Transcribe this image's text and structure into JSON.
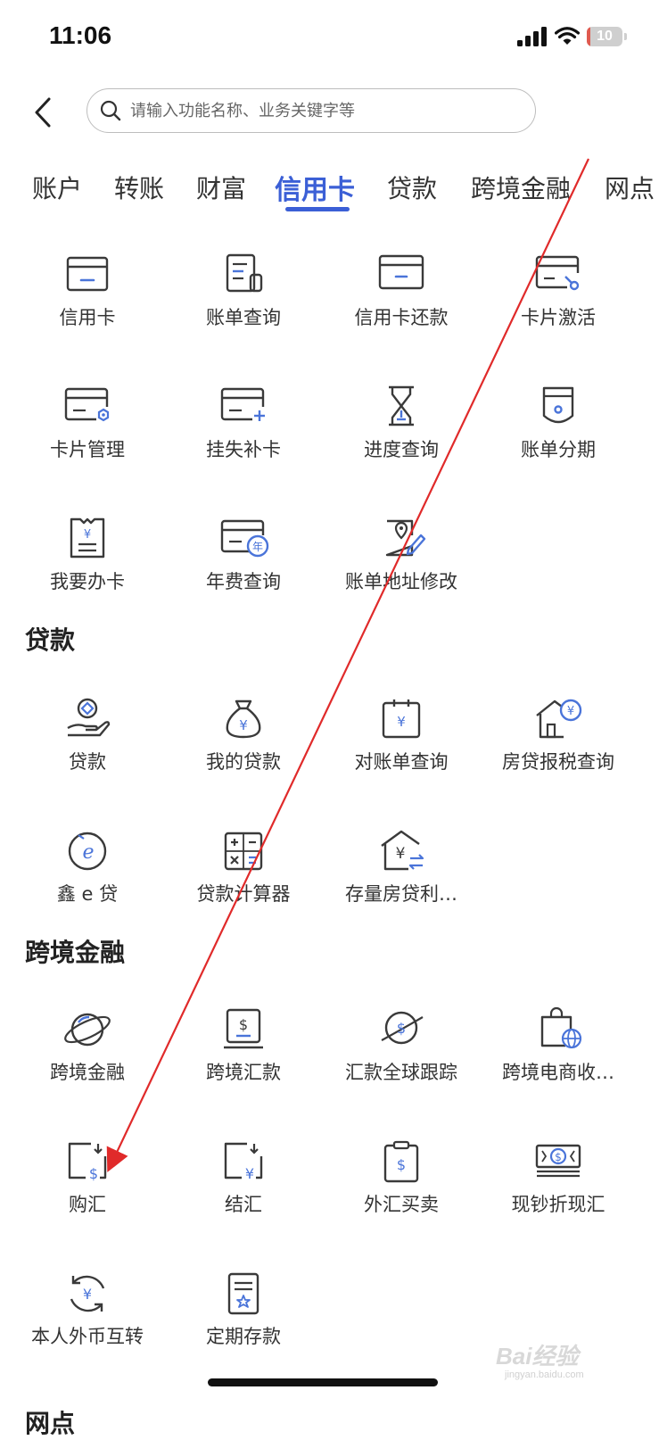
{
  "status": {
    "time": "11:06",
    "battery": "10",
    "battery_level": 0.1
  },
  "header": {
    "search_placeholder": "请输入功能名称、业务关键字等"
  },
  "tabs": [
    {
      "label": "账户"
    },
    {
      "label": "转账"
    },
    {
      "label": "财富"
    },
    {
      "label": "信用卡",
      "active": true
    },
    {
      "label": "贷款"
    },
    {
      "label": "跨境金融"
    },
    {
      "label": "网点"
    }
  ],
  "credit_card": {
    "items": [
      {
        "label": "信用卡",
        "icon": "credit-card-icon"
      },
      {
        "label": "账单查询",
        "icon": "bill-query-icon"
      },
      {
        "label": "信用卡还款",
        "icon": "card-repay-icon"
      },
      {
        "label": "卡片激活",
        "icon": "card-activate-icon"
      },
      {
        "label": "卡片管理",
        "icon": "card-manage-icon"
      },
      {
        "label": "挂失补卡",
        "icon": "card-replace-icon"
      },
      {
        "label": "进度查询",
        "icon": "hourglass-icon"
      },
      {
        "label": "账单分期",
        "icon": "installment-icon"
      },
      {
        "label": "我要办卡",
        "icon": "apply-card-icon"
      },
      {
        "label": "年费查询",
        "icon": "annual-fee-icon"
      },
      {
        "label": "账单地址修改",
        "icon": "address-edit-icon"
      }
    ]
  },
  "loans": {
    "title": "贷款",
    "items": [
      {
        "label": "贷款",
        "icon": "loan-icon"
      },
      {
        "label": "我的贷款",
        "icon": "money-bag-icon"
      },
      {
        "label": "对账单查询",
        "icon": "statement-icon"
      },
      {
        "label": "房贷报税查询",
        "icon": "house-tax-icon"
      },
      {
        "label": "鑫 e 贷",
        "icon": "e-loan-icon"
      },
      {
        "label": "贷款计算器",
        "icon": "calculator-icon"
      },
      {
        "label": "存量房贷利…",
        "icon": "house-rate-icon"
      }
    ]
  },
  "cross_border": {
    "title": "跨境金融",
    "items": [
      {
        "label": "跨境金融",
        "icon": "planet-icon"
      },
      {
        "label": "跨境汇款",
        "icon": "remittance-icon"
      },
      {
        "label": "汇款全球跟踪",
        "icon": "global-track-icon"
      },
      {
        "label": "跨境电商收…",
        "icon": "ecommerce-bag-icon"
      },
      {
        "label": "购汇",
        "icon": "buy-fx-icon"
      },
      {
        "label": "结汇",
        "icon": "settle-fx-icon"
      },
      {
        "label": "外汇买卖",
        "icon": "fx-trade-icon"
      },
      {
        "label": "现钞折现汇",
        "icon": "cash-convert-icon"
      },
      {
        "label": "本人外币互转",
        "icon": "fx-exchange-icon"
      },
      {
        "label": "定期存款",
        "icon": "deposit-icon"
      }
    ]
  },
  "outlets": {
    "title": "网点"
  },
  "watermark": {
    "main": "Bai经验",
    "sub": "jingyan.baidu.com"
  },
  "colors": {
    "accent": "#3b5fd6",
    "icon_stroke": "#3a3a3a",
    "icon_accent": "#4a74d9",
    "arrow": "#e02a2a"
  }
}
